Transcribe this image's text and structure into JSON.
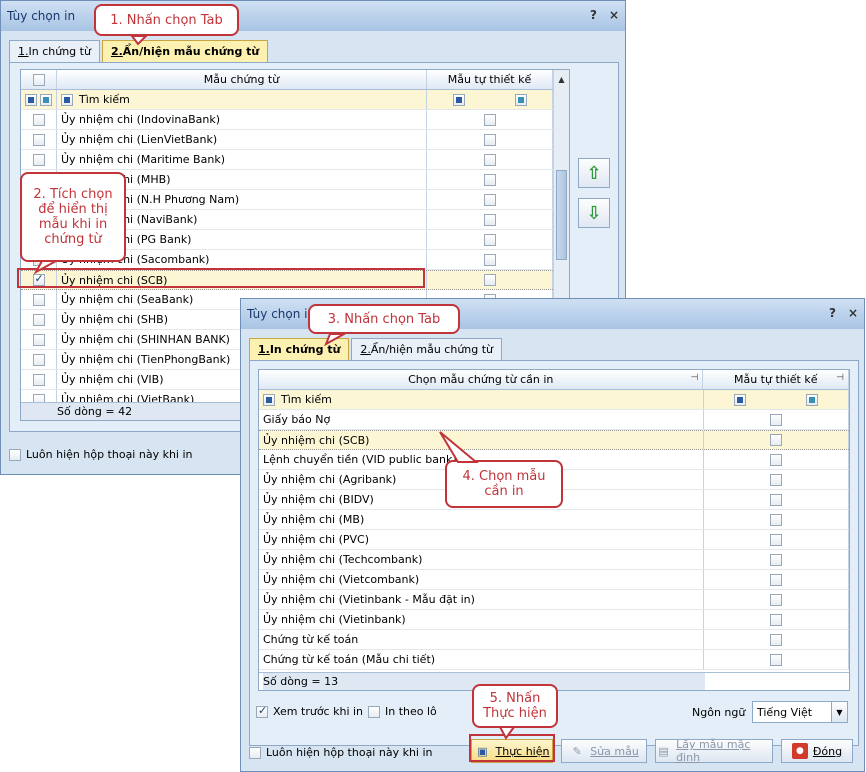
{
  "dialog1": {
    "title": "Tùy chọn in",
    "title_icons": [
      "?",
      "×"
    ],
    "tabs": [
      {
        "key": "1.",
        "label": " In chứng từ"
      },
      {
        "key": "2.",
        "label": " Ẩn/hiện mẫu chứng từ"
      }
    ],
    "grid": {
      "headers": [
        "Mẫu chứng từ",
        "Mẫu tự thiết kế"
      ],
      "search_label": "Tìm kiếm",
      "rows": [
        "Ủy nhiệm chi (IndovinaBank)",
        "Ủy nhiệm chi (LienVietBank)",
        "Ủy nhiệm chi (Maritime Bank)",
        "Ủy nhiệm chi (MHB)",
        "Ủy nhiệm chi (N.H Phương Nam)",
        "Ủy nhiệm chi (NaviBank)",
        "Ủy nhiệm chi (PG Bank)",
        "Ủy nhiệm chi (Sacombank)",
        "Ủy nhiệm chi (SCB)",
        "Ủy nhiệm chi (SeaBank)",
        "Ủy nhiệm chi (SHB)",
        "Ủy nhiệm chi (SHINHAN BANK)",
        "Ủy nhiệm chi (TienPhongBank)",
        "Ủy nhiệm chi (VIB)",
        "Ủy nhiệm chi (VietBank)"
      ],
      "checked_row": 8,
      "row_count": "Số dòng = 42"
    },
    "always_show": "Luôn hiện hộp thoại này khi in"
  },
  "dialog2": {
    "title": "Tùy chọn in",
    "title_icons": [
      "?",
      "×"
    ],
    "tabs": [
      {
        "key": "1.",
        "label": " In chứng từ"
      },
      {
        "key": "2.",
        "label": " Ẩn/hiện mẫu chứng từ"
      }
    ],
    "grid": {
      "headers": [
        "Chọn mẫu chứng từ cần in",
        "Mẫu tự thiết kế"
      ],
      "search_label": "Tìm kiếm",
      "rows": [
        "Giấy báo Nợ",
        "Ủy nhiệm chi (SCB)",
        "Lệnh chuyển tiền (VID public bank)",
        "Ủy nhiệm chi (Agribank)",
        "Ủy nhiệm chi (BIDV)",
        "Ủy nhiệm chi (MB)",
        "Ủy nhiệm chi (PVC)",
        "Ủy nhiệm chi (Techcombank)",
        "Ủy nhiệm chi (Vietcombank)",
        "Ủy nhiệm chi (Vietinbank - Mẫu đặt in)",
        "Ủy nhiệm chi (Vietinbank)",
        "Chứng từ kế toán",
        "Chứng từ kế toán (Mẫu chi tiết)"
      ],
      "selected_row": 1,
      "row_count": "Số dòng = 13"
    },
    "preview_label": "Xem trước khi in",
    "batch_label": "In theo lô",
    "language_label": "Ngôn ngữ",
    "language_value": "Tiếng Việt",
    "always_show": "Luôn hiện hộp thoại này khi in",
    "buttons": {
      "execute": "Thực hiện",
      "edit": "Sửa mẫu",
      "default": "Lấy mẫu mặc định",
      "close": "Đóng"
    }
  },
  "callouts": {
    "c1": "1. Nhấn chọn Tab",
    "c2": "2. Tích chọn để hiển thị mẫu khi in chứng từ",
    "c3": "3. Nhấn chọn Tab",
    "c4": "4. Chọn mẫu cần in",
    "c5": "5. Nhấn Thực hiện"
  },
  "colors": {
    "accent": "#c0343a",
    "title_bg": "#a9c4e4",
    "active_tab": "#fdf1b2"
  }
}
